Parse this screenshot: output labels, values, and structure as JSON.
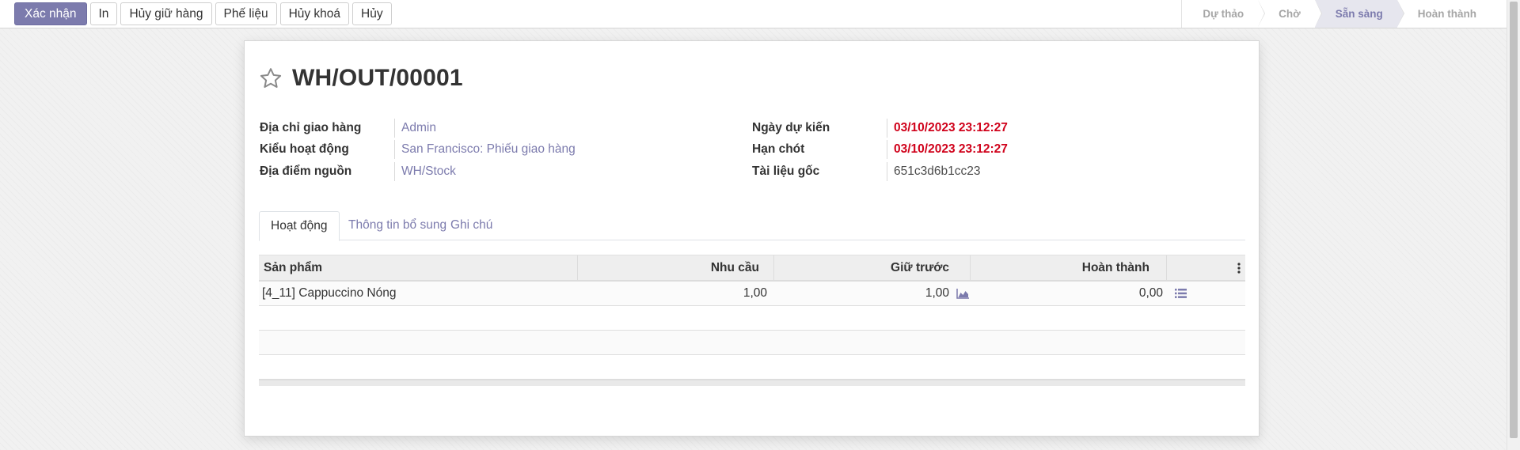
{
  "toolbar": {
    "buttons": [
      "Xác nhận",
      "In",
      "Hủy giữ hàng",
      "Phế liệu",
      "Hủy khoá",
      "Hủy"
    ]
  },
  "statusbar": {
    "stages": [
      "Dự thảo",
      "Chờ",
      "Sẵn sàng",
      "Hoàn thành"
    ],
    "active": "Sẵn sàng"
  },
  "record": {
    "title": "WH/OUT/00001",
    "left_fields": [
      {
        "label": "Địa chỉ giao hàng",
        "value": "Admin"
      },
      {
        "label": "Kiểu hoạt động",
        "value": "San Francisco: Phiếu giao hàng"
      },
      {
        "label": "Địa điểm nguồn",
        "value": "WH/Stock"
      }
    ],
    "right_fields": [
      {
        "label": "Ngày dự kiến",
        "value": "03/10/2023 23:12:27"
      },
      {
        "label": "Hạn chót",
        "value": "03/10/2023 23:12:27"
      },
      {
        "label": "Tài liệu gốc",
        "value": "651c3d6b1cc23"
      }
    ]
  },
  "tabs": [
    "Hoạt động",
    "Thông tin bổ sung",
    "Ghi chú"
  ],
  "table": {
    "headers": [
      "Sản phẩm",
      "Nhu cầu",
      "Giữ trước",
      "Hoàn thành"
    ],
    "rows": [
      {
        "product": "[4_11] Cappuccino Nóng",
        "demand": "1,00",
        "reserved": "1,00",
        "done": "0,00"
      }
    ]
  },
  "colors": {
    "accent": "#7c7bad",
    "danger": "#d0021b"
  }
}
